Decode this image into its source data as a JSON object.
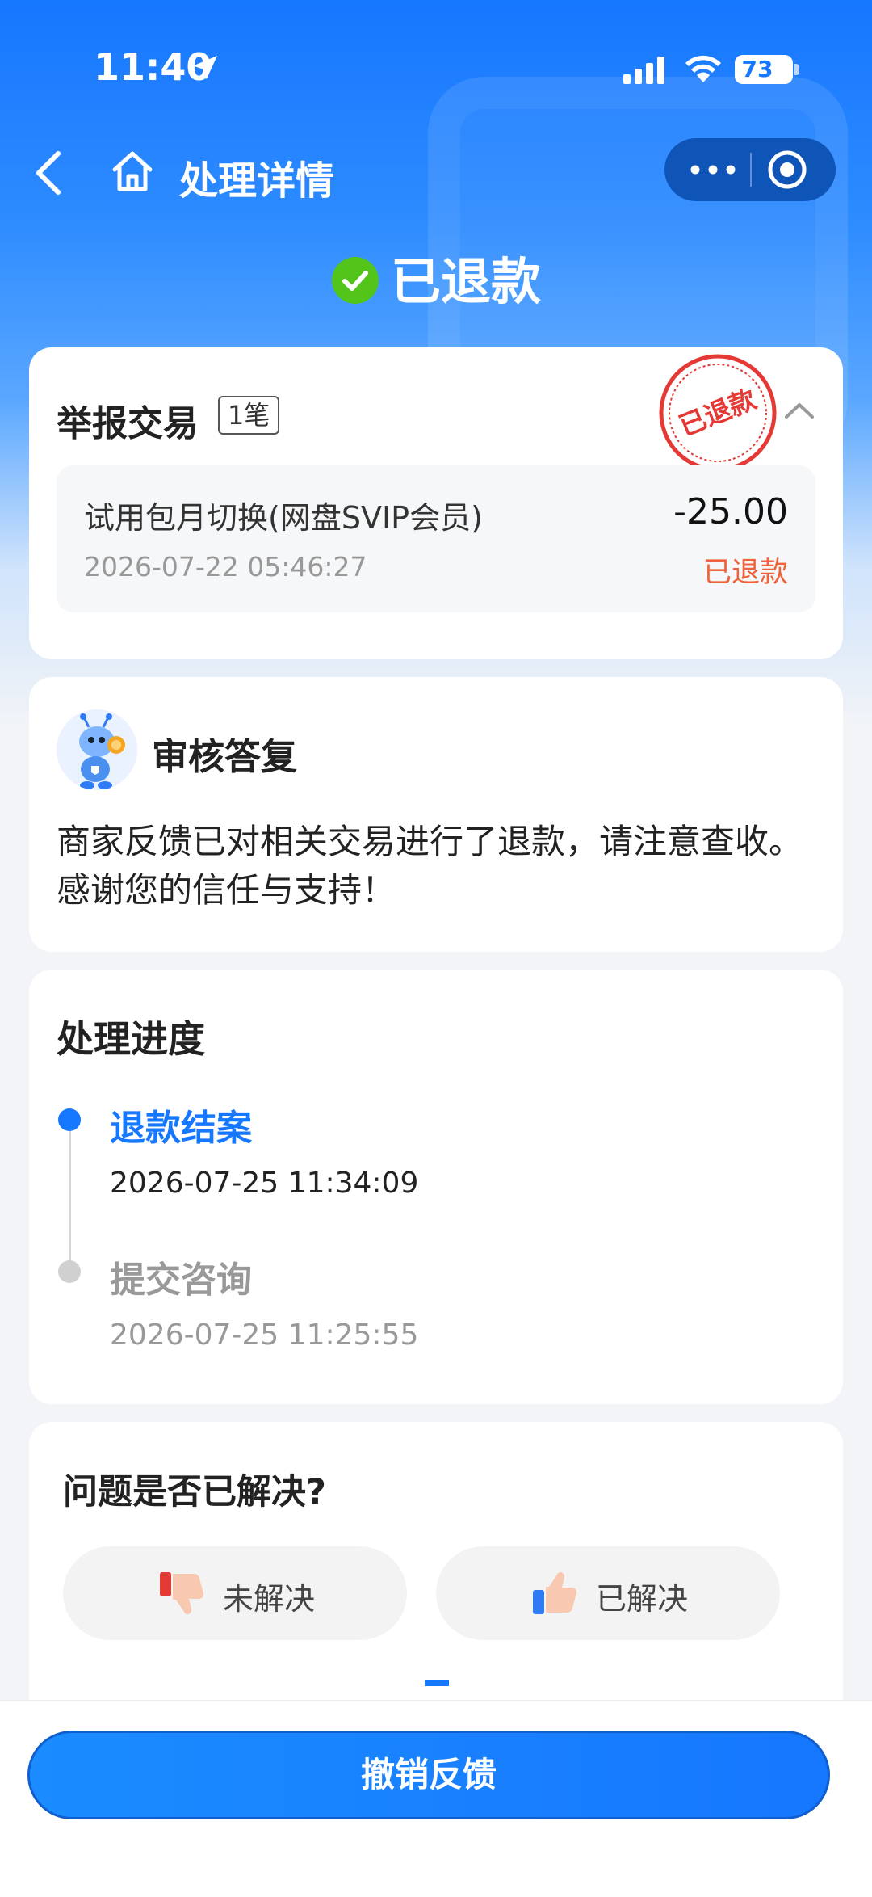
{
  "status_bar": {
    "time": "11:40",
    "battery": "73"
  },
  "nav": {
    "title": "处理详情"
  },
  "hero": {
    "status": "已退款"
  },
  "report_card": {
    "title": "举报交易",
    "count_badge": "1笔",
    "stamp_text": "已退款",
    "transaction": {
      "name": "试用包月切换(网盘SVIP会员)",
      "amount": "-25.00",
      "date": "2026-07-22 05:46:27",
      "status": "已退款"
    }
  },
  "reply_card": {
    "title": "审核答复",
    "body": "商家反馈已对相关交易进行了退款，请注意查收。感谢您的信任与支持！"
  },
  "progress_card": {
    "title": "处理进度",
    "steps": [
      {
        "label": "退款结案",
        "time": "2026-07-25 11:34:09"
      },
      {
        "label": "提交咨询",
        "time": "2026-07-25 11:25:55"
      }
    ]
  },
  "feedback_card": {
    "question": "问题是否已解决?",
    "unresolved_label": "未解决",
    "resolved_label": "已解决"
  },
  "bottom": {
    "cta_label": "撤销反馈"
  },
  "colors": {
    "primary": "#1677ff",
    "refund_orange": "#f0623a",
    "stamp_red": "#e53935",
    "success_green": "#52c41a"
  }
}
